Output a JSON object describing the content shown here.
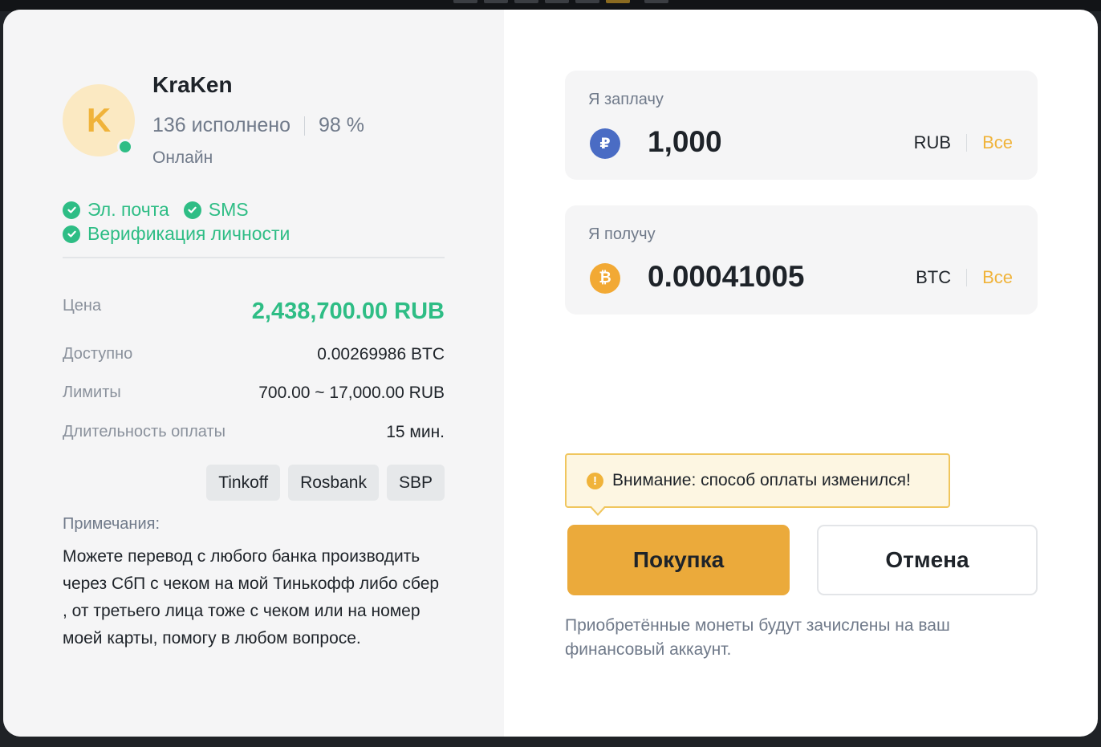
{
  "seller": {
    "avatar_letter": "K",
    "name": "KraKen",
    "orders_completed": "136 исполнено",
    "completion_rate": "98 %",
    "status": "Онлайн",
    "verifications": [
      "Эл. почта",
      "SMS",
      "Верификация личности"
    ]
  },
  "details": {
    "price_label": "Цена",
    "price_value": "2,438,700.00 RUB",
    "available_label": "Доступно",
    "available_value": "0.00269986 BTC",
    "limits_label": "Лимиты",
    "limits_value": "700.00 ~ 17,000.00 RUB",
    "duration_label": "Длительность оплаты",
    "duration_value": "15 мин.",
    "payment_methods": [
      "Tinkoff",
      "Rosbank",
      "SBP"
    ]
  },
  "notes": {
    "title": "Примечания:",
    "text": "Можете перевод с любого банка производить через СбП с чеком на мой Тинькофф либо сбер , от третьего лица тоже с чеком или на номер моей карты, помогу в любом вопросе."
  },
  "pay": {
    "label": "Я заплачу",
    "coin_icon": "ruble-coin-icon",
    "coin_symbol": "₽",
    "amount": "1,000",
    "currency": "RUB",
    "all_label": "Все"
  },
  "receive": {
    "label": "Я получу",
    "coin_icon": "bitcoin-coin-icon",
    "coin_symbol": "₿",
    "amount": "0.00041005",
    "currency": "BTC",
    "all_label": "Все"
  },
  "warning": {
    "icon": "exclamation-icon",
    "text": "Внимание: способ оплаты изменился!"
  },
  "buttons": {
    "buy": "Покупка",
    "cancel": "Отмена"
  },
  "footer_note": "Приобретённые монеты будут зачислены на ваш финансовый аккаунт.",
  "colors": {
    "accent": "#ebaa3b",
    "success": "#2ebd85",
    "ruble_coin": "#4a6cc4",
    "bitcoin_coin": "#f2a934"
  }
}
